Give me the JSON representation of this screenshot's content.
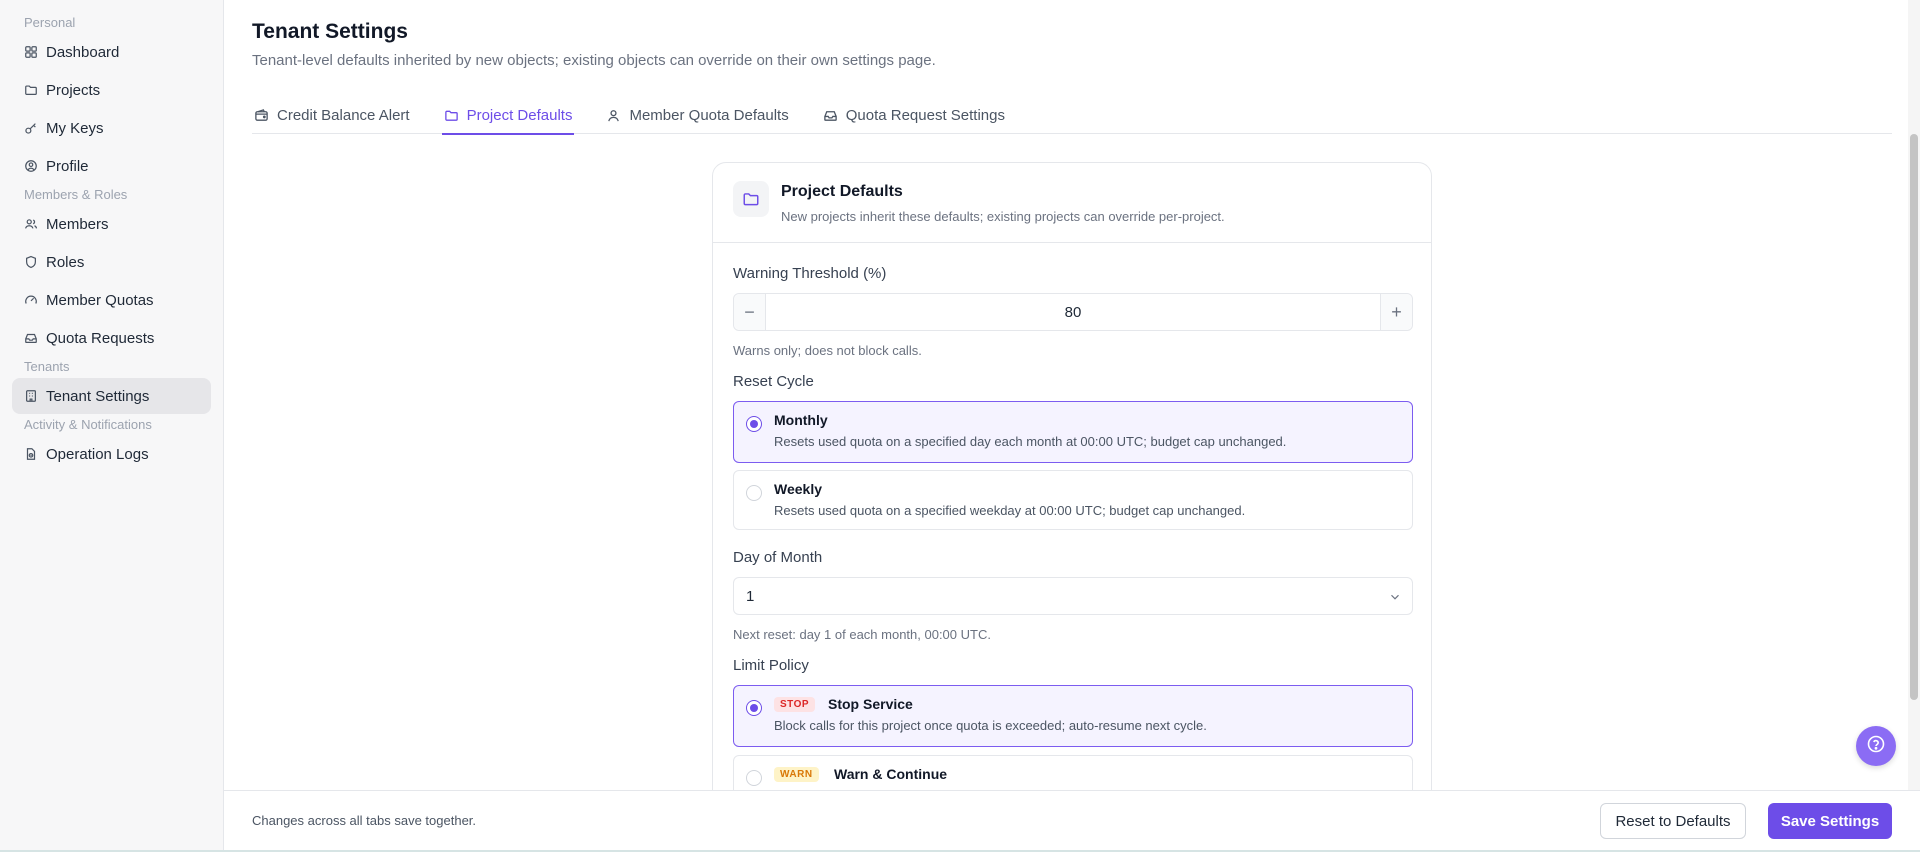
{
  "sidebar": {
    "sections": [
      {
        "label": "Personal",
        "items": [
          {
            "label": "Dashboard",
            "icon": "dashboard-icon"
          },
          {
            "label": "Projects",
            "icon": "folder-icon"
          },
          {
            "label": "My Keys",
            "icon": "key-icon"
          },
          {
            "label": "Profile",
            "icon": "user-circle-icon"
          }
        ]
      },
      {
        "label": "Members & Roles",
        "items": [
          {
            "label": "Members",
            "icon": "users-icon"
          },
          {
            "label": "Roles",
            "icon": "shield-icon"
          },
          {
            "label": "Member Quotas",
            "icon": "gauge-icon"
          },
          {
            "label": "Quota Requests",
            "icon": "inbox-icon"
          }
        ]
      },
      {
        "label": "Tenants",
        "items": [
          {
            "label": "Tenant Settings",
            "icon": "building-icon",
            "active": true
          }
        ]
      },
      {
        "label": "Activity & Notifications",
        "items": [
          {
            "label": "Operation Logs",
            "icon": "log-icon"
          }
        ]
      }
    ]
  },
  "header": {
    "title": "Tenant Settings",
    "subtitle": "Tenant-level defaults inherited by new objects; existing objects can override on their own settings page."
  },
  "tabs": [
    {
      "label": "Credit Balance Alert",
      "icon": "wallet-icon",
      "active": false
    },
    {
      "label": "Project Defaults",
      "icon": "folder-icon",
      "active": true
    },
    {
      "label": "Member Quota Defaults",
      "icon": "user-icon",
      "active": false
    },
    {
      "label": "Quota Request Settings",
      "icon": "inbox-icon",
      "active": false
    }
  ],
  "card": {
    "title": "Project Defaults",
    "description": "New projects inherit these defaults; existing projects can override per-project.",
    "warning_threshold": {
      "label": "Warning Threshold (%)",
      "value": "80",
      "hint": "Warns only; does not block calls."
    },
    "reset_cycle": {
      "label": "Reset Cycle",
      "options": [
        {
          "title": "Monthly",
          "description": "Resets used quota on a specified day each month at 00:00 UTC; budget cap unchanged.",
          "selected": true
        },
        {
          "title": "Weekly",
          "description": "Resets used quota on a specified weekday at 00:00 UTC; budget cap unchanged.",
          "selected": false
        }
      ]
    },
    "day_of_month": {
      "label": "Day of Month",
      "value": "1",
      "hint": "Next reset: day 1 of each month, 00:00 UTC."
    },
    "limit_policy": {
      "label": "Limit Policy",
      "options": [
        {
          "badge": "STOP",
          "title": "Stop Service",
          "description": "Block calls for this project once quota is exceeded; auto-resume next cycle.",
          "selected": true
        },
        {
          "badge": "WARN",
          "title": "Warn & Continue",
          "description": "",
          "selected": false
        }
      ]
    }
  },
  "footer": {
    "note": "Changes across all tabs save together.",
    "reset_label": "Reset to Defaults",
    "save_label": "Save Settings"
  },
  "colors": {
    "accent": "#6d4de8",
    "stop_badge": "#dc2626",
    "warn_badge": "#d97706"
  }
}
